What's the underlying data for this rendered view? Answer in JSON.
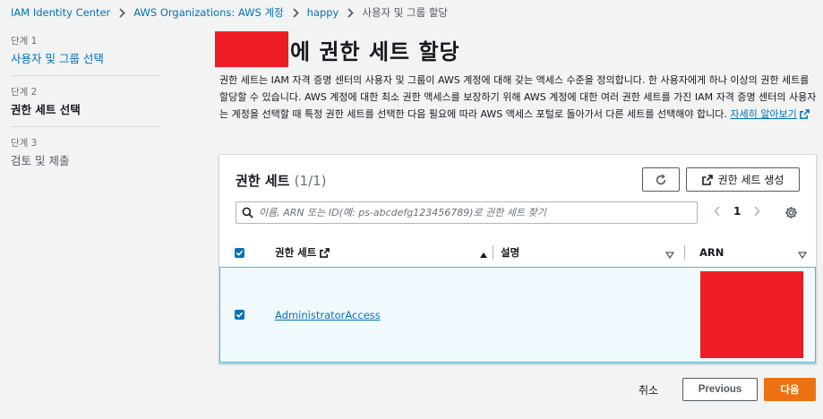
{
  "breadcrumb": {
    "items": [
      "IAM Identity Center",
      "AWS Organizations: AWS 계정",
      "happy"
    ],
    "current": "사용자 및 그룹 할당"
  },
  "steps": [
    {
      "num": "단계 1",
      "label": "사용자 및 그룹 선택"
    },
    {
      "num": "단계 2",
      "label": "권한 세트 선택"
    },
    {
      "num": "단계 3",
      "label": "검토 및 제출"
    }
  ],
  "page": {
    "title": "에 권한 세트 할당",
    "description": "권한 세트는 IAM 자격 증명 센터의 사용자 및 그룹이 AWS 계정에 대해 갖는 액세스 수준을 정의합니다. 한 사용자에게 하나 이상의 권한 세트를 할당할 수 있습니다. AWS 계정에 대한 최소 권한 액세스를 보장하기 위해 AWS 계정에 대한 여러 권한 세트를 가진 IAM 자격 증명 센터의 사용자는 계정을 선택할 때 특정 권한 세트를 선택한 다음 필요에 따라 AWS 액세스 포털로 돌아가서 다른 세트를 선택해야 합니다. ",
    "learn_more": "자세히 알아보기"
  },
  "panel": {
    "title": "권한 세트",
    "count": "(1/1)",
    "create_label": "권한 세트 생성",
    "search_placeholder": "이름, ARN 또는 ID(예: ps-abcdefg123456789)로 권한 세트 찾기",
    "page_number": "1",
    "columns": [
      "권한 세트",
      "설명",
      "ARN"
    ],
    "rows": [
      {
        "name": "AdministratorAccess",
        "description": "",
        "checked": true
      }
    ]
  },
  "footer": {
    "cancel": "취소",
    "previous": "Previous",
    "next": "다음"
  },
  "colors": {
    "link": "#0073bb",
    "primary": "#ec7211",
    "selected_row": "#f1faff",
    "redaction": "#ee1c25"
  }
}
